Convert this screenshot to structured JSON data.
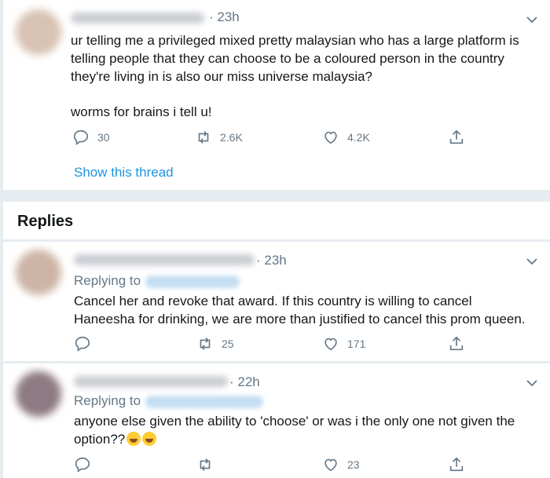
{
  "tweet": {
    "time": "· 23h",
    "lines": [
      "ur telling me a privileged mixed pretty malaysian who has a large platform is",
      "telling people that they can choose to be a coloured person in the country",
      "they're living in is also our miss universe malaysia?",
      "worms for brains i tell u!"
    ],
    "reply_count": "30",
    "retweet_count": "2.6K",
    "like_count": "4.2K",
    "show_thread": "Show this thread"
  },
  "replies_heading": "Replies",
  "reply1": {
    "time": "· 23h",
    "replying_to": "Replying to",
    "lines": [
      "Cancel her and revoke that award. If this country is willing to cancel",
      "Haneesha for drinking, we are more than justified to cancel this prom queen."
    ],
    "reply_count": "",
    "retweet_count": "25",
    "like_count": "171"
  },
  "reply2": {
    "time": "· 22h",
    "replying_to": "Replying to",
    "lines": [
      "anyone else given the ability to 'choose' or was i the only one not given the",
      "option??"
    ],
    "retweet_count": "",
    "like_count": "23"
  },
  "colors": {
    "link": "#1b95e0",
    "muted": "#657786",
    "background": "#e6ecf0"
  }
}
